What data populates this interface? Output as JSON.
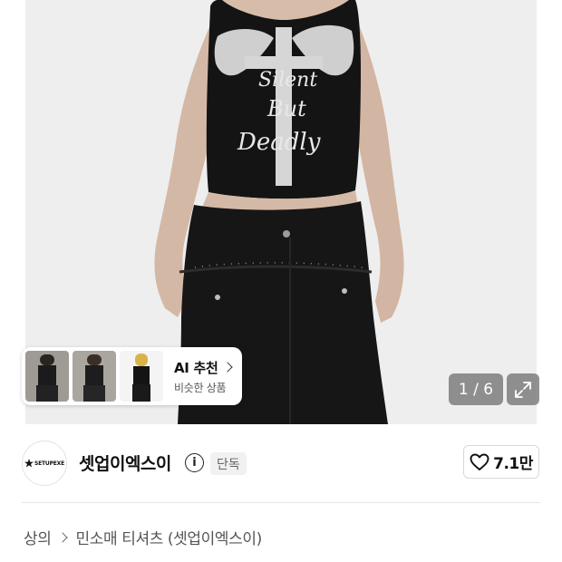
{
  "hero": {
    "image_alt": "product photo",
    "print_text": [
      "Silent",
      "But",
      "Deadly"
    ],
    "counter": "1 / 6",
    "ai_card": {
      "title": "AI 추천",
      "subtitle": "비슷한 상품"
    }
  },
  "brand": {
    "logo_text": "SETUPEXE",
    "name": "셋업이엑스이",
    "badge": "단독",
    "like_count": "7.1만"
  },
  "breadcrumb": {
    "items": [
      "상의",
      "민소매 티셔츠 (셋업이엑스이)"
    ]
  },
  "colors": {
    "background": "#ffffff",
    "photo_bg": "#f0f0f0",
    "overlay": "#6e6e6e",
    "text": "#111111",
    "muted": "#555555"
  }
}
